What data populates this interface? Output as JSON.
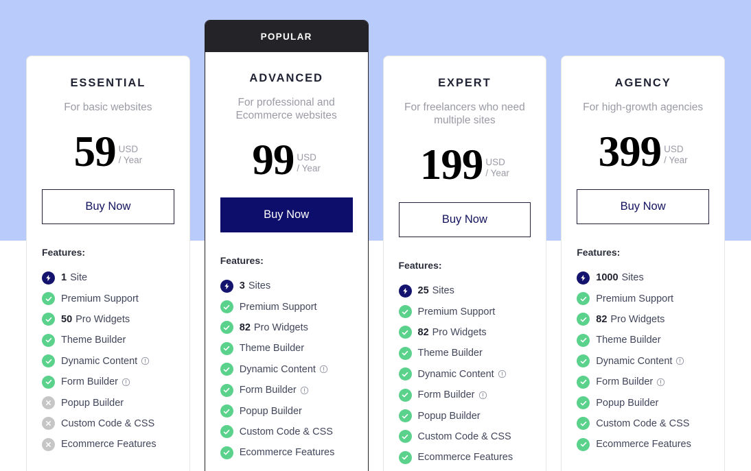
{
  "colors": {
    "page_background": "#b8cbfb",
    "card_background": "#ffffff",
    "badge_background": "#242428",
    "primary_button": "#0d0d6b",
    "included_icon": "#5bd28c",
    "excluded_icon": "#c6c6c6",
    "bolt_icon": "#14146e"
  },
  "plans": [
    {
      "name": "ESSENTIAL",
      "description": "For basic websites",
      "price": "59",
      "currency": "USD",
      "period": "/ Year",
      "cta_label": "Buy Now",
      "featured": false,
      "badge": null,
      "features_title": "Features:",
      "features": [
        {
          "icon": "bolt-icon",
          "value": "1",
          "label": "Site"
        },
        {
          "icon": "check-circle-icon",
          "value": "",
          "label": "Premium Support"
        },
        {
          "icon": "check-circle-icon",
          "value": "50",
          "label": "Pro Widgets"
        },
        {
          "icon": "check-circle-icon",
          "value": "",
          "label": "Theme Builder"
        },
        {
          "icon": "check-circle-icon",
          "value": "",
          "label": "Dynamic Content",
          "info": true
        },
        {
          "icon": "check-circle-icon",
          "value": "",
          "label": "Form Builder",
          "info": true
        },
        {
          "icon": "cross-circle-icon",
          "value": "",
          "label": "Popup Builder"
        },
        {
          "icon": "cross-circle-icon",
          "value": "",
          "label": "Custom Code & CSS"
        },
        {
          "icon": "cross-circle-icon",
          "value": "",
          "label": "Ecommerce Features"
        }
      ]
    },
    {
      "name": "ADVANCED",
      "description": "For professional and Ecommerce websites",
      "price": "99",
      "currency": "USD",
      "period": "/ Year",
      "cta_label": "Buy Now",
      "featured": true,
      "badge": "POPULAR",
      "features_title": "Features:",
      "features": [
        {
          "icon": "bolt-icon",
          "value": "3",
          "label": "Sites"
        },
        {
          "icon": "check-circle-icon",
          "value": "",
          "label": "Premium Support"
        },
        {
          "icon": "check-circle-icon",
          "value": "82",
          "label": "Pro Widgets"
        },
        {
          "icon": "check-circle-icon",
          "value": "",
          "label": "Theme Builder"
        },
        {
          "icon": "check-circle-icon",
          "value": "",
          "label": "Dynamic Content",
          "info": true
        },
        {
          "icon": "check-circle-icon",
          "value": "",
          "label": "Form Builder",
          "info": true
        },
        {
          "icon": "check-circle-icon",
          "value": "",
          "label": "Popup Builder"
        },
        {
          "icon": "check-circle-icon",
          "value": "",
          "label": "Custom Code & CSS"
        },
        {
          "icon": "check-circle-icon",
          "value": "",
          "label": "Ecommerce Features"
        }
      ]
    },
    {
      "name": "EXPERT",
      "description": "For freelancers who need multiple sites",
      "price": "199",
      "currency": "USD",
      "period": "/ Year",
      "cta_label": "Buy Now",
      "featured": false,
      "badge": null,
      "features_title": "Features:",
      "features": [
        {
          "icon": "bolt-icon",
          "value": "25",
          "label": "Sites"
        },
        {
          "icon": "check-circle-icon",
          "value": "",
          "label": "Premium Support"
        },
        {
          "icon": "check-circle-icon",
          "value": "82",
          "label": "Pro Widgets"
        },
        {
          "icon": "check-circle-icon",
          "value": "",
          "label": "Theme Builder"
        },
        {
          "icon": "check-circle-icon",
          "value": "",
          "label": "Dynamic Content",
          "info": true
        },
        {
          "icon": "check-circle-icon",
          "value": "",
          "label": "Form Builder",
          "info": true
        },
        {
          "icon": "check-circle-icon",
          "value": "",
          "label": "Popup Builder"
        },
        {
          "icon": "check-circle-icon",
          "value": "",
          "label": "Custom Code & CSS"
        },
        {
          "icon": "check-circle-icon",
          "value": "",
          "label": "Ecommerce Features"
        }
      ]
    },
    {
      "name": "AGENCY",
      "description": "For high-growth agencies",
      "price": "399",
      "currency": "USD",
      "period": "/ Year",
      "cta_label": "Buy Now",
      "featured": false,
      "badge": null,
      "features_title": "Features:",
      "features": [
        {
          "icon": "bolt-icon",
          "value": "1000",
          "label": "Sites"
        },
        {
          "icon": "check-circle-icon",
          "value": "",
          "label": "Premium Support"
        },
        {
          "icon": "check-circle-icon",
          "value": "82",
          "label": "Pro Widgets"
        },
        {
          "icon": "check-circle-icon",
          "value": "",
          "label": "Theme Builder"
        },
        {
          "icon": "check-circle-icon",
          "value": "",
          "label": "Dynamic Content",
          "info": true
        },
        {
          "icon": "check-circle-icon",
          "value": "",
          "label": "Form Builder",
          "info": true
        },
        {
          "icon": "check-circle-icon",
          "value": "",
          "label": "Popup Builder"
        },
        {
          "icon": "check-circle-icon",
          "value": "",
          "label": "Custom Code & CSS"
        },
        {
          "icon": "check-circle-icon",
          "value": "",
          "label": "Ecommerce Features"
        }
      ]
    }
  ]
}
